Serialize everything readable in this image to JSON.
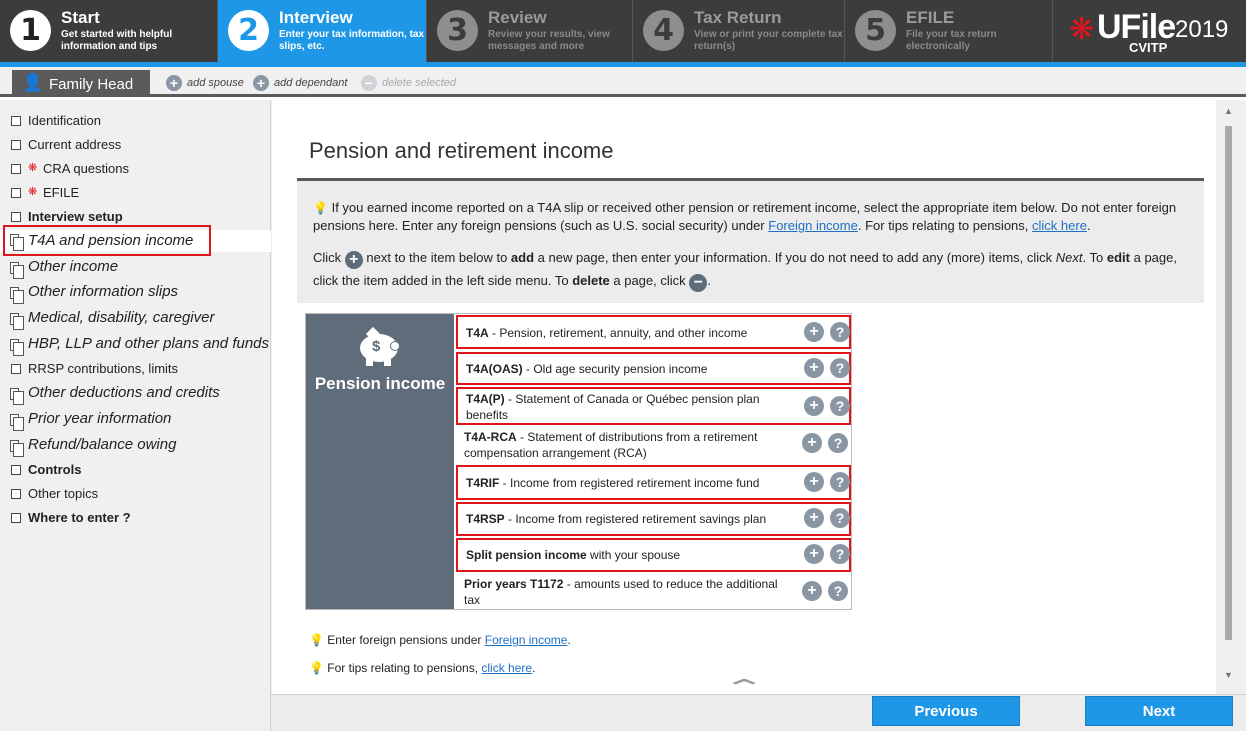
{
  "steps": [
    {
      "num": "1",
      "title": "Start",
      "desc": "Get started with helpful information and tips"
    },
    {
      "num": "2",
      "title": "Interview",
      "desc": "Enter your tax information, tax slips, etc."
    },
    {
      "num": "3",
      "title": "Review",
      "desc": "Review your results, view messages and more"
    },
    {
      "num": "4",
      "title": "Tax Return",
      "desc": "View or print your complete tax return(s)"
    },
    {
      "num": "5",
      "title": "EFILE",
      "desc": "File your tax return electronically"
    }
  ],
  "brand": {
    "name": "UFile",
    "year": "2019",
    "edition": "CVITP"
  },
  "family": {
    "tab": "Family Head",
    "add_spouse": "add spouse",
    "add_dependant": "add dependant",
    "delete_selected": "delete selected"
  },
  "sidebar": {
    "items": [
      {
        "label": "Identification"
      },
      {
        "label": "Current address"
      },
      {
        "label": "CRA questions"
      },
      {
        "label": "EFILE"
      },
      {
        "label": "Interview setup"
      },
      {
        "label": "T4A and pension income"
      },
      {
        "label": "Other income"
      },
      {
        "label": "Other information slips"
      },
      {
        "label": "Medical, disability, caregiver"
      },
      {
        "label": "HBP, LLP and other plans and funds"
      },
      {
        "label": "RRSP contributions, limits"
      },
      {
        "label": "Other deductions and credits"
      },
      {
        "label": "Prior year information"
      },
      {
        "label": "Refund/balance owing"
      },
      {
        "label": "Controls"
      },
      {
        "label": "Other topics"
      },
      {
        "label": "Where to enter ?"
      }
    ]
  },
  "main": {
    "title": "Pension and retirement income",
    "info1_a": "If you earned income reported on a T4A slip or received other pension or retirement income, select the appropriate item below. Do not enter foreign pensions here. Enter any foreign pensions (such as U.S. social security) under ",
    "info1_link1": "Foreign income",
    "info1_b": ". For tips relating to pensions, ",
    "info1_link2": "click here",
    "info1_c": ".",
    "info2_a": "Click ",
    "info2_b": " next to the item below to ",
    "info2_add": "add",
    "info2_c": " a new page, then enter your information. If you do not need to add any (more) items, click ",
    "info2_next": "Next",
    "info2_d": ". To ",
    "info2_edit": "edit",
    "info2_e": " a page, click the item added in the left side menu. To ",
    "info2_delete": "delete",
    "info2_f": " a page, click ",
    "info2_g": ".",
    "category": "Pension income",
    "rows": [
      {
        "code": "T4A",
        "desc": " - Pension, retirement, annuity, and other income"
      },
      {
        "code": "T4A(OAS)",
        "desc": " - Old age security pension income"
      },
      {
        "code": "T4A(P)",
        "desc": " - Statement of Canada or Québec pension plan benefits"
      },
      {
        "code": "T4A-RCA",
        "desc": " - Statement of distributions from a retirement compensation arrangement (RCA)"
      },
      {
        "code": "T4RIF",
        "desc": " - Income from registered retirement income fund"
      },
      {
        "code": "T4RSP",
        "desc": " - Income from registered retirement savings plan"
      },
      {
        "code": "Split pension income",
        "desc": " with your spouse"
      },
      {
        "code": "Prior years T1172",
        "desc": " - amounts used to reduce the additional tax"
      }
    ],
    "tip1_a": "Enter foreign pensions under ",
    "tip1_link": "Foreign income",
    "tip1_b": ".",
    "tip2_a": "For tips relating to pensions, ",
    "tip2_link": "click here",
    "tip2_b": "."
  },
  "buttons": {
    "previous": "Previous",
    "next": "Next"
  },
  "icons": {
    "add": "plus-circle-icon",
    "help": "question-circle-icon",
    "tip": "lightbulb-icon",
    "leaf": "maple-leaf-icon"
  },
  "colors": {
    "accent": "#1e98e6",
    "highlight": "#e0141c",
    "category_bg": "#5f6c7a"
  }
}
